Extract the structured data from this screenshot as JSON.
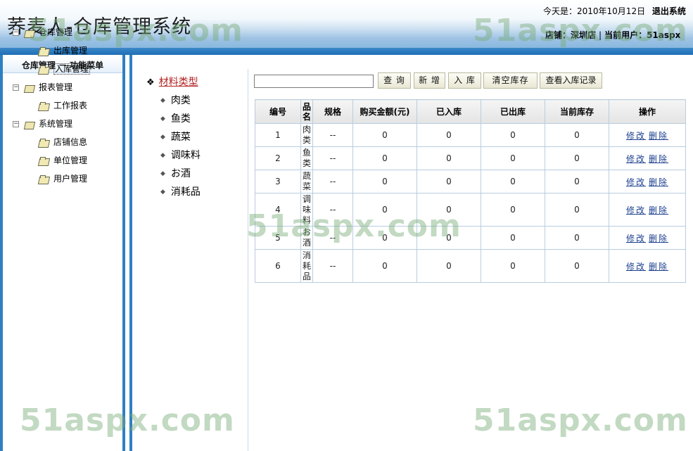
{
  "header": {
    "title": "荞麦人-仓库管理系统",
    "date_text": "今天是：2010年10月12日",
    "logout_label": "退出系统",
    "store_label": "店铺：深圳店",
    "user_label": "当前用户：51aspx"
  },
  "sidebar": {
    "title": "仓库管理 － 功能菜单",
    "groups": [
      {
        "label": "仓库管理",
        "items": [
          {
            "label": "出库管理"
          },
          {
            "label": "入库管理"
          }
        ]
      },
      {
        "label": "报表管理",
        "items": [
          {
            "label": "工作报表"
          }
        ]
      },
      {
        "label": "系统管理",
        "items": [
          {
            "label": "店铺信息"
          },
          {
            "label": "单位管理"
          },
          {
            "label": "用户管理"
          }
        ]
      }
    ],
    "toggle_symbol": "−"
  },
  "categories": {
    "head": "材料类型",
    "items": [
      "肉类",
      "鱼类",
      "蔬菜",
      "调味料",
      "お酒",
      "消耗品"
    ]
  },
  "toolbar": {
    "search_value": "",
    "buttons": [
      "查 询",
      "新 增",
      "入 库",
      "清空库存",
      "查看入库记录"
    ]
  },
  "table": {
    "headers": [
      "编号",
      "品名",
      "规格",
      "购买金额(元)",
      "已入库",
      "已出库",
      "当前库存",
      "操作"
    ],
    "rows": [
      {
        "id": "1",
        "name": "肉类",
        "spec": "--",
        "amount": "0",
        "in": "0",
        "out": "0",
        "stock": "0"
      },
      {
        "id": "2",
        "name": "鱼类",
        "spec": "--",
        "amount": "0",
        "in": "0",
        "out": "0",
        "stock": "0"
      },
      {
        "id": "3",
        "name": "蔬菜",
        "spec": "--",
        "amount": "0",
        "in": "0",
        "out": "0",
        "stock": "0"
      },
      {
        "id": "4",
        "name": "调味料",
        "spec": "--",
        "amount": "0",
        "in": "0",
        "out": "0",
        "stock": "0"
      },
      {
        "id": "5",
        "name": "お酒",
        "spec": "--",
        "amount": "0",
        "in": "0",
        "out": "0",
        "stock": "0"
      },
      {
        "id": "6",
        "name": "消耗品",
        "spec": "--",
        "amount": "0",
        "in": "0",
        "out": "0",
        "stock": "0"
      }
    ],
    "edit_label": "修改",
    "delete_label": "删除"
  },
  "watermark": "51aspx.com",
  "colors": {
    "accent_blue": "#2f7fc3",
    "link": "#1b3f8f",
    "category_head": "#b22222"
  }
}
